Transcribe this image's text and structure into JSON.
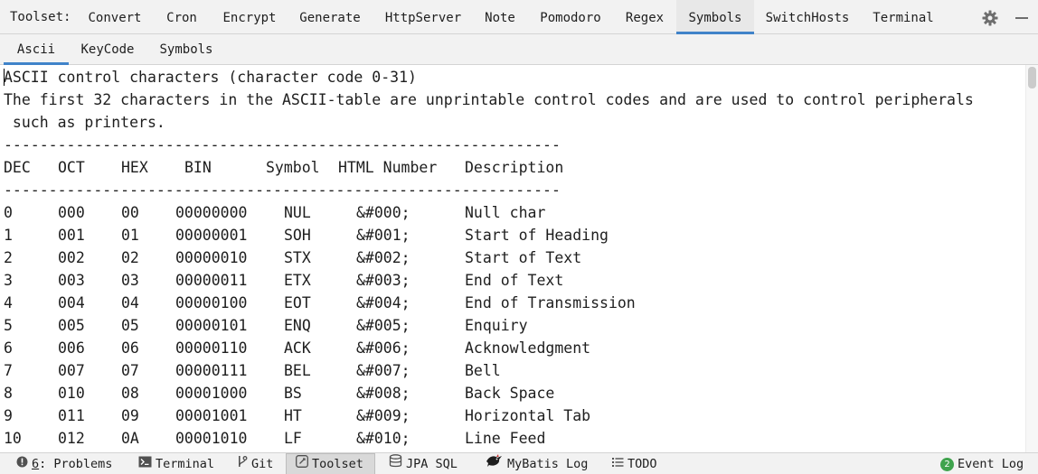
{
  "toolbar": {
    "label": "Toolset:",
    "tabs": [
      "Convert",
      "Cron",
      "Encrypt",
      "Generate",
      "HttpServer",
      "Note",
      "Pomodoro",
      "Regex",
      "Symbols",
      "SwitchHosts",
      "Terminal"
    ],
    "active_tab": "Symbols",
    "settings_icon": "gear-icon",
    "minimize_icon": "minimize-icon"
  },
  "subtabs": {
    "tabs": [
      "Ascii",
      "KeyCode",
      "Symbols"
    ],
    "active_tab": "Ascii"
  },
  "content": {
    "title": "ASCII control characters (character code 0-31)",
    "description_line1": "The first 32 characters in the ASCII-table are unprintable control codes and are used to control peripherals",
    "description_line2": " such as printers.",
    "separator": "--------------------------------------------------------------",
    "headers": [
      "DEC",
      "OCT",
      "HEX",
      "BIN",
      "Symbol",
      "HTML Number",
      "Description"
    ],
    "rows": [
      [
        "0",
        "000",
        "00",
        "00000000",
        "NUL",
        "&#000;",
        "Null char"
      ],
      [
        "1",
        "001",
        "01",
        "00000001",
        "SOH",
        "&#001;",
        "Start of Heading"
      ],
      [
        "2",
        "002",
        "02",
        "00000010",
        "STX",
        "&#002;",
        "Start of Text"
      ],
      [
        "3",
        "003",
        "03",
        "00000011",
        "ETX",
        "&#003;",
        "End of Text"
      ],
      [
        "4",
        "004",
        "04",
        "00000100",
        "EOT",
        "&#004;",
        "End of Transmission"
      ],
      [
        "5",
        "005",
        "05",
        "00000101",
        "ENQ",
        "&#005;",
        "Enquiry"
      ],
      [
        "6",
        "006",
        "06",
        "00000110",
        "ACK",
        "&#006;",
        "Acknowledgment"
      ],
      [
        "7",
        "007",
        "07",
        "00000111",
        "BEL",
        "&#007;",
        "Bell"
      ],
      [
        "8",
        "010",
        "08",
        "00001000",
        "BS",
        "&#008;",
        "Back Space"
      ],
      [
        "9",
        "011",
        "09",
        "00001001",
        "HT",
        "&#009;",
        "Horizontal Tab"
      ],
      [
        "10",
        "012",
        "0A",
        "00001010",
        "LF",
        "&#010;",
        "Line Feed"
      ]
    ]
  },
  "statusbar": {
    "items": [
      {
        "shortcut": "6",
        "label": ": Problems",
        "icon": "problems-icon"
      },
      {
        "label": "Terminal",
        "icon": "terminal-icon"
      },
      {
        "label": "Git",
        "icon": "git-branch-icon"
      },
      {
        "label": "Toolset",
        "icon": "toolset-icon"
      },
      {
        "label": "JPA SQL",
        "icon": "database-icon"
      },
      {
        "label": "MyBatis Log",
        "icon": "mybatis-bird-icon"
      },
      {
        "label": "TODO",
        "icon": "todo-list-icon"
      }
    ],
    "active_item": "Toolset",
    "event_log": {
      "count": "2",
      "label": "Event Log",
      "badge_color": "#3fa34d"
    }
  },
  "colors": {
    "accent": "#4083c9",
    "background": "#f2f2f2",
    "editor_background": "#ffffff"
  }
}
